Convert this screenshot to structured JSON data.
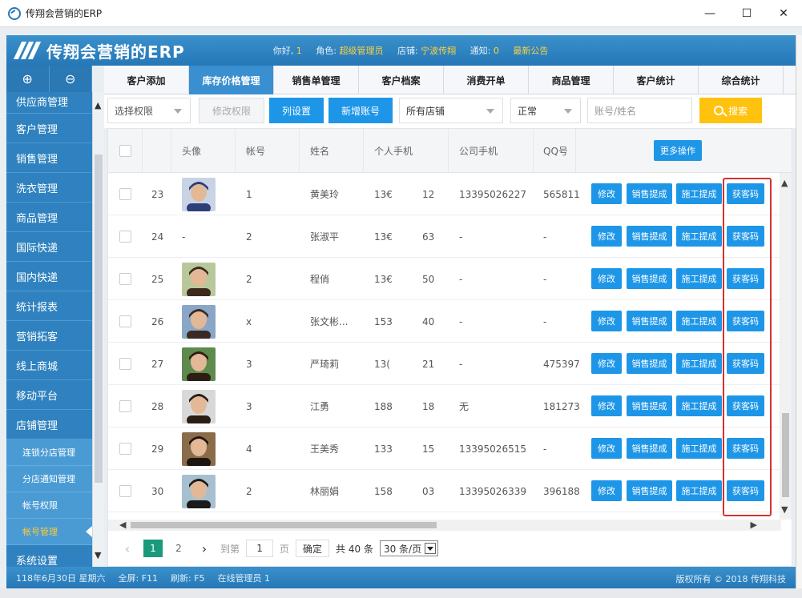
{
  "window": {
    "title": "传翔会营销的ERP",
    "min": "—",
    "max": "☐",
    "close": "✕"
  },
  "header": {
    "logo_text": "传翔会营销的ERP",
    "greeting": "你好,",
    "user": "1",
    "role_label": "角色:",
    "role": "超级管理员",
    "store_label": "店铺:",
    "store": "宁波传翔",
    "notice_label": "通知:",
    "notice_count": "0",
    "latest_notice": "最新公告"
  },
  "sidebar": {
    "expand": "⊕",
    "collapse": "⊖",
    "partial_item": "供应商管理",
    "items": [
      "客户管理",
      "销售管理",
      "洗衣管理",
      "商品管理",
      "国际快递",
      "国内快递",
      "统计报表",
      "营销拓客",
      "线上商城",
      "移动平台",
      "店铺管理"
    ],
    "sub_items": [
      "连锁分店管理",
      "分店通知管理",
      "帐号权限",
      "帐号管理"
    ],
    "active_sub": "帐号管理",
    "last_item": "系统设置"
  },
  "tabs": [
    {
      "label": "客户添加"
    },
    {
      "label": "库存价格管理",
      "active": true
    },
    {
      "label": "销售单管理"
    },
    {
      "label": "客户档案"
    },
    {
      "label": "消费开单"
    },
    {
      "label": "商品管理"
    },
    {
      "label": "客户统计"
    },
    {
      "label": "综合统计"
    }
  ],
  "toolbar": {
    "permission_select": "选择权限",
    "modify_permission": "修改权限",
    "column_settings": "列设置",
    "add_account": "新增账号",
    "store_select": "所有店铺",
    "status_select": "正常",
    "search_placeholder": "账号/姓名",
    "search_label": "搜索"
  },
  "table": {
    "headers": {
      "avatar": "头像",
      "account": "帐号",
      "name": "姓名",
      "mobile": "个人手机",
      "company_phone": "公司手机",
      "qq": "QQ号"
    },
    "more_actions": "更多操作",
    "action_labels": {
      "edit": "修改",
      "sales_commission": "销售提成",
      "work_commission": "施工提成",
      "get_code": "获客码"
    },
    "rows": [
      {
        "index": "23",
        "avatar": "photo",
        "account": "1",
        "name": "黄美玲",
        "mobile_a": "13€",
        "mobile_b": "12",
        "company_phone": "13395026227",
        "qq": "565811"
      },
      {
        "index": "24",
        "avatar": "-",
        "account": "2",
        "name": "张淑平",
        "mobile_a": "13€",
        "mobile_b": "63",
        "company_phone": "-",
        "qq": "-"
      },
      {
        "index": "25",
        "avatar": "photo",
        "account": "2",
        "name": "程俏",
        "mobile_a": "13€",
        "mobile_b": "50",
        "company_phone": "-",
        "qq": "-"
      },
      {
        "index": "26",
        "avatar": "photo",
        "account": "x",
        "name": "张文彬...",
        "mobile_a": "153",
        "mobile_b": "40",
        "company_phone": "-",
        "qq": "-"
      },
      {
        "index": "27",
        "avatar": "photo",
        "account": "3",
        "name": "严琦莉",
        "mobile_a": "13(",
        "mobile_b": "21",
        "company_phone": "-",
        "qq": "475397"
      },
      {
        "index": "28",
        "avatar": "photo",
        "account": "3",
        "name": "江勇",
        "mobile_a": "188",
        "mobile_b": "18",
        "company_phone": "无",
        "qq": "181273"
      },
      {
        "index": "29",
        "avatar": "photo",
        "account": "4",
        "name": "王美秀",
        "mobile_a": "133",
        "mobile_b": "15",
        "company_phone": "13395026515",
        "qq": "-"
      },
      {
        "index": "30",
        "avatar": "photo",
        "account": "2",
        "name": "林丽娟",
        "mobile_a": "158",
        "mobile_b": "03",
        "company_phone": "13395026339",
        "qq": "396188"
      }
    ]
  },
  "pager": {
    "prev": "‹",
    "page1": "1",
    "page2": "2",
    "next": "›",
    "goto_label": "到第",
    "goto_value": "1",
    "page_unit": "页",
    "confirm": "确定",
    "total": "共 40 条",
    "page_size": "30 条/页"
  },
  "status": {
    "date": "118年6月30日 星期六",
    "fullscreen": "全屏: F11",
    "refresh": "刷新: F5",
    "online": "在线管理员 1",
    "copyright": "版权所有 © 2018 传翔科技"
  },
  "colors": {
    "primary": "#2677b6",
    "button": "#1e96e8",
    "highlight": "#d93030",
    "accent_yellow": "#ffc20e",
    "current_page": "#1a9a7c"
  }
}
